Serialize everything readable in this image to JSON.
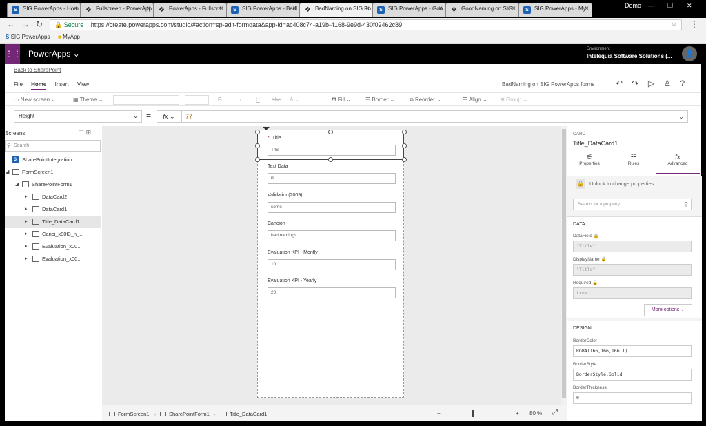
{
  "browser": {
    "tabs": [
      {
        "label": "SIG PowerApps - Hom",
        "favicon": "S"
      },
      {
        "label": "Fullscreen - PowerApp",
        "favicon": "PA"
      },
      {
        "label": "PowerApps - Fullscre",
        "favicon": "PA"
      },
      {
        "label": "SIG PowerApps - Badl",
        "favicon": "S"
      },
      {
        "label": "BadNaming on SIG Po",
        "favicon": "PA"
      },
      {
        "label": "SIG PowerApps - Goo",
        "favicon": "S"
      },
      {
        "label": "GoodNaming on SIG",
        "favicon": "PA"
      },
      {
        "label": "SIG PowerApps - My",
        "favicon": "S"
      }
    ],
    "profile": "Demo",
    "secure_label": "Secure",
    "url": "https://create.powerapps.com/studio/#action=sp-edit-formdata&app-id=ac408c74-a19b-4168-9e9d-430f02462c89",
    "bookmarks": [
      "SIG PowerApps",
      "MyApp"
    ]
  },
  "header": {
    "app_title": "PowerApps",
    "env_label": "Environment",
    "env_name": "Intelequia Software Solutions (..."
  },
  "studio": {
    "back_link": "Back to SharePoint",
    "menu_tabs": [
      "File",
      "Home",
      "Insert",
      "View"
    ],
    "active_menu": "Home",
    "app_name": "BadNaming on SIG PowerApps forms",
    "toolbar": {
      "new_screen": "New screen",
      "theme": "Theme",
      "bold": "B",
      "italic": "/",
      "underline": "U",
      "strike": "abc",
      "font": "A",
      "fill": "Fill",
      "border": "Border",
      "reorder": "Reorder",
      "align": "Align",
      "group": "Group"
    },
    "formula_bar": {
      "property": "Height",
      "equals": "=",
      "fx": "fx",
      "value": "77"
    }
  },
  "tree": {
    "title": "Screens",
    "search_placeholder": "Search",
    "nodes": [
      {
        "label": "SharePointIntegration"
      },
      {
        "label": "FormScreen1"
      },
      {
        "label": "SharePointForm1"
      },
      {
        "label": "DataCard2"
      },
      {
        "label": "DataCard1"
      },
      {
        "label": "Title_DataCard1"
      },
      {
        "label": "Canci_x00f3_n_..."
      },
      {
        "label": "Evaluation_x00..."
      },
      {
        "label": "Evaluation_x00..."
      }
    ]
  },
  "form": {
    "cards": [
      {
        "label": "Title",
        "value": "This",
        "required": "*"
      },
      {
        "label": "Text Data",
        "value": "is"
      },
      {
        "label": "Validation(2009)",
        "value": "some"
      },
      {
        "label": "Canción",
        "value": "bad namings"
      },
      {
        "label": "Evaluation KPI - Montly",
        "value": "10"
      },
      {
        "label": "Evaluation KPI - Yearly",
        "value": "20"
      }
    ]
  },
  "bottom": {
    "crumbs": [
      "FormScreen1",
      "SharePointForm1",
      "Title_DataCard1"
    ],
    "zoom_minus": "−",
    "zoom_plus": "+",
    "zoom_value": "80",
    "zoom_unit": "%",
    "zoom_level": 0.4
  },
  "properties": {
    "kind": "CARD",
    "name": "Title_DataCard1",
    "tabs": [
      "Properties",
      "Rules",
      "Advanced"
    ],
    "active_tab": "Advanced",
    "unlock_text": "Unlock to change properties.",
    "search_placeholder": "Search for a property ...",
    "data_section": "DATA",
    "datafield_label": "DataField",
    "datafield_value": "\"Title\"",
    "displayname_label": "DisplayName",
    "displayname_value": "\"Title\"",
    "required_label": "Required",
    "required_value": "true",
    "more_options": "More options",
    "design_section": "DESIGN",
    "bordercolor_label": "BorderColor",
    "bordercolor_value": "RGBA(166,166,166,1)",
    "borderstyle_label": "BorderStyle",
    "borderstyle_value": "BorderStyle.Solid",
    "borderthickness_label": "BorderThickness",
    "borderthickness_value": "0"
  },
  "colors": {
    "brand": "#742774",
    "header_bg": "#000000",
    "canvas_bg": "#ebebeb"
  }
}
